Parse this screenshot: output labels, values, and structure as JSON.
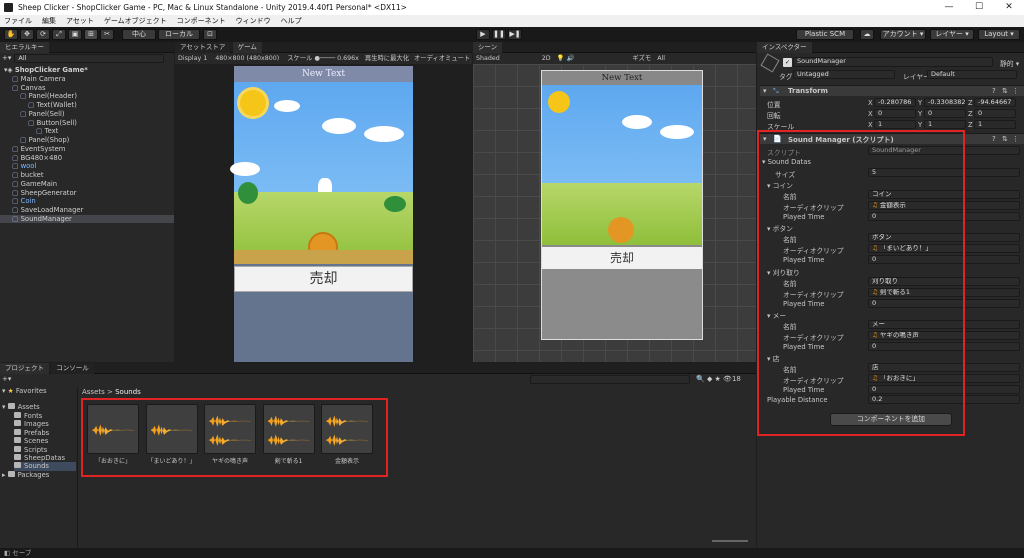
{
  "window": {
    "title": "Sheep Clicker - ShopClicker Game - PC, Mac & Linux Standalone - Unity 2019.4.40f1 Personal* <DX11>",
    "min": "—",
    "max": "☐",
    "close": "✕"
  },
  "menu": [
    "ファイル",
    "編集",
    "アセット",
    "ゲームオブジェクト",
    "コンポーネント",
    "ウィンドウ",
    "ヘルプ"
  ],
  "toolbar": {
    "center": "中心",
    "local": "ローカル",
    "plastic": "Plastic SCM",
    "account": "アカウント ▾",
    "layers": "レイヤー ▾",
    "layout": "Layout ▾"
  },
  "hierarchy": {
    "tab": "ヒエラルキー",
    "search_placeholder": "All",
    "items": [
      {
        "label": "ShopClicker Game*",
        "indent": 0
      },
      {
        "label": "Main Camera",
        "indent": 1
      },
      {
        "label": "Canvas",
        "indent": 1
      },
      {
        "label": "Panel(Header)",
        "indent": 2
      },
      {
        "label": "Text(Wallet)",
        "indent": 3
      },
      {
        "label": "Panel(Sell)",
        "indent": 2
      },
      {
        "label": "Button(Sell)",
        "indent": 3
      },
      {
        "label": "Text",
        "indent": 4
      },
      {
        "label": "Panel(Shop)",
        "indent": 2
      },
      {
        "label": "EventSystem",
        "indent": 1
      },
      {
        "label": "BG480×480",
        "indent": 1
      },
      {
        "label": "wool",
        "indent": 1
      },
      {
        "label": "bucket",
        "indent": 1
      },
      {
        "label": "GameMain",
        "indent": 1
      },
      {
        "label": "SheepGenerator",
        "indent": 1
      },
      {
        "label": "Coin",
        "indent": 1
      },
      {
        "label": "SaveLoadManager",
        "indent": 1
      },
      {
        "label": "SoundManager",
        "indent": 1
      }
    ]
  },
  "game": {
    "tabs": [
      "アセットストア",
      "ゲーム"
    ],
    "display": "Display 1",
    "resolution": "480×800 (480x800)",
    "scale_label": "スケール",
    "scale_value": "0.696x",
    "maximize": "再生時に最大化",
    "audio": "オーディオミュート",
    "header_text": "New Text",
    "sell_text": "売却"
  },
  "scene": {
    "tab": "シーン",
    "shading": "Shaded",
    "mode2d": "2D",
    "gizmos": "ギズモ",
    "search_placeholder": "All",
    "header_text": "New Text",
    "sell_text": "売却"
  },
  "inspector": {
    "tab": "インスペクター",
    "object_name": "SoundManager",
    "static": "静的 ▾",
    "tag_label": "タグ",
    "tag_value": "Untagged",
    "layer_label": "レイヤー",
    "layer_value": "Default",
    "transform": {
      "title": "Transform",
      "position_label": "位置",
      "rotation_label": "回転",
      "scale_label": "スケール",
      "position": [
        "-0.280786",
        "-0.3308382",
        "-94.64667"
      ],
      "rotation": [
        "0",
        "0",
        "0"
      ],
      "scale": [
        "1",
        "1",
        "1"
      ]
    },
    "component": {
      "title": "Sound Manager (スクリプト)",
      "script_label": "スクリプト",
      "script_value": "SoundManager",
      "datas_label": "Sound Datas",
      "size_label": "サイズ",
      "size_value": "5",
      "entries": [
        {
          "header": "コイン",
          "name_label": "名前",
          "name": "コイン",
          "clip_label": "オーディオクリップ",
          "clip": "金額表示",
          "played_label": "Played Time",
          "played": "0"
        },
        {
          "header": "ボタン",
          "name_label": "名前",
          "name": "ボタン",
          "clip_label": "オーディオクリップ",
          "clip": "「まいどあり！」",
          "played_label": "Played Time",
          "played": "0"
        },
        {
          "header": "刈り取り",
          "name_label": "名前",
          "name": "刈り取り",
          "clip_label": "オーディオクリップ",
          "clip": "剣で斬る1",
          "played_label": "Played Time",
          "played": "0"
        },
        {
          "header": "メー",
          "name_label": "名前",
          "name": "メー",
          "clip_label": "オーディオクリップ",
          "clip": "ヤギの鳴き声",
          "played_label": "Played Time",
          "played": "0"
        },
        {
          "header": "店",
          "name_label": "名前",
          "name": "店",
          "clip_label": "オーディオクリップ",
          "clip": "「おおきに」",
          "played_label": "Played Time",
          "played": "0"
        }
      ],
      "playable_label": "Playable Distance",
      "playable_value": "0.2"
    },
    "add_component": "コンポーネントを追加"
  },
  "project": {
    "tabs": [
      "プロジェクト",
      "コンソール"
    ],
    "favorites": "Favorites",
    "assets": "Assets",
    "folders": [
      "Fonts",
      "Images",
      "Prefabs",
      "Scenes",
      "Scripts",
      "SheepDatas",
      "Sounds"
    ],
    "packages": "Packages",
    "breadcrumb": [
      "Assets",
      "Sounds"
    ],
    "count": "18",
    "files": [
      "「おおきに」",
      "「まいどあり！」",
      "ヤギの鳴き声",
      "剣で斬る1",
      "金額表示"
    ]
  },
  "status": {
    "text": "セーブ"
  }
}
